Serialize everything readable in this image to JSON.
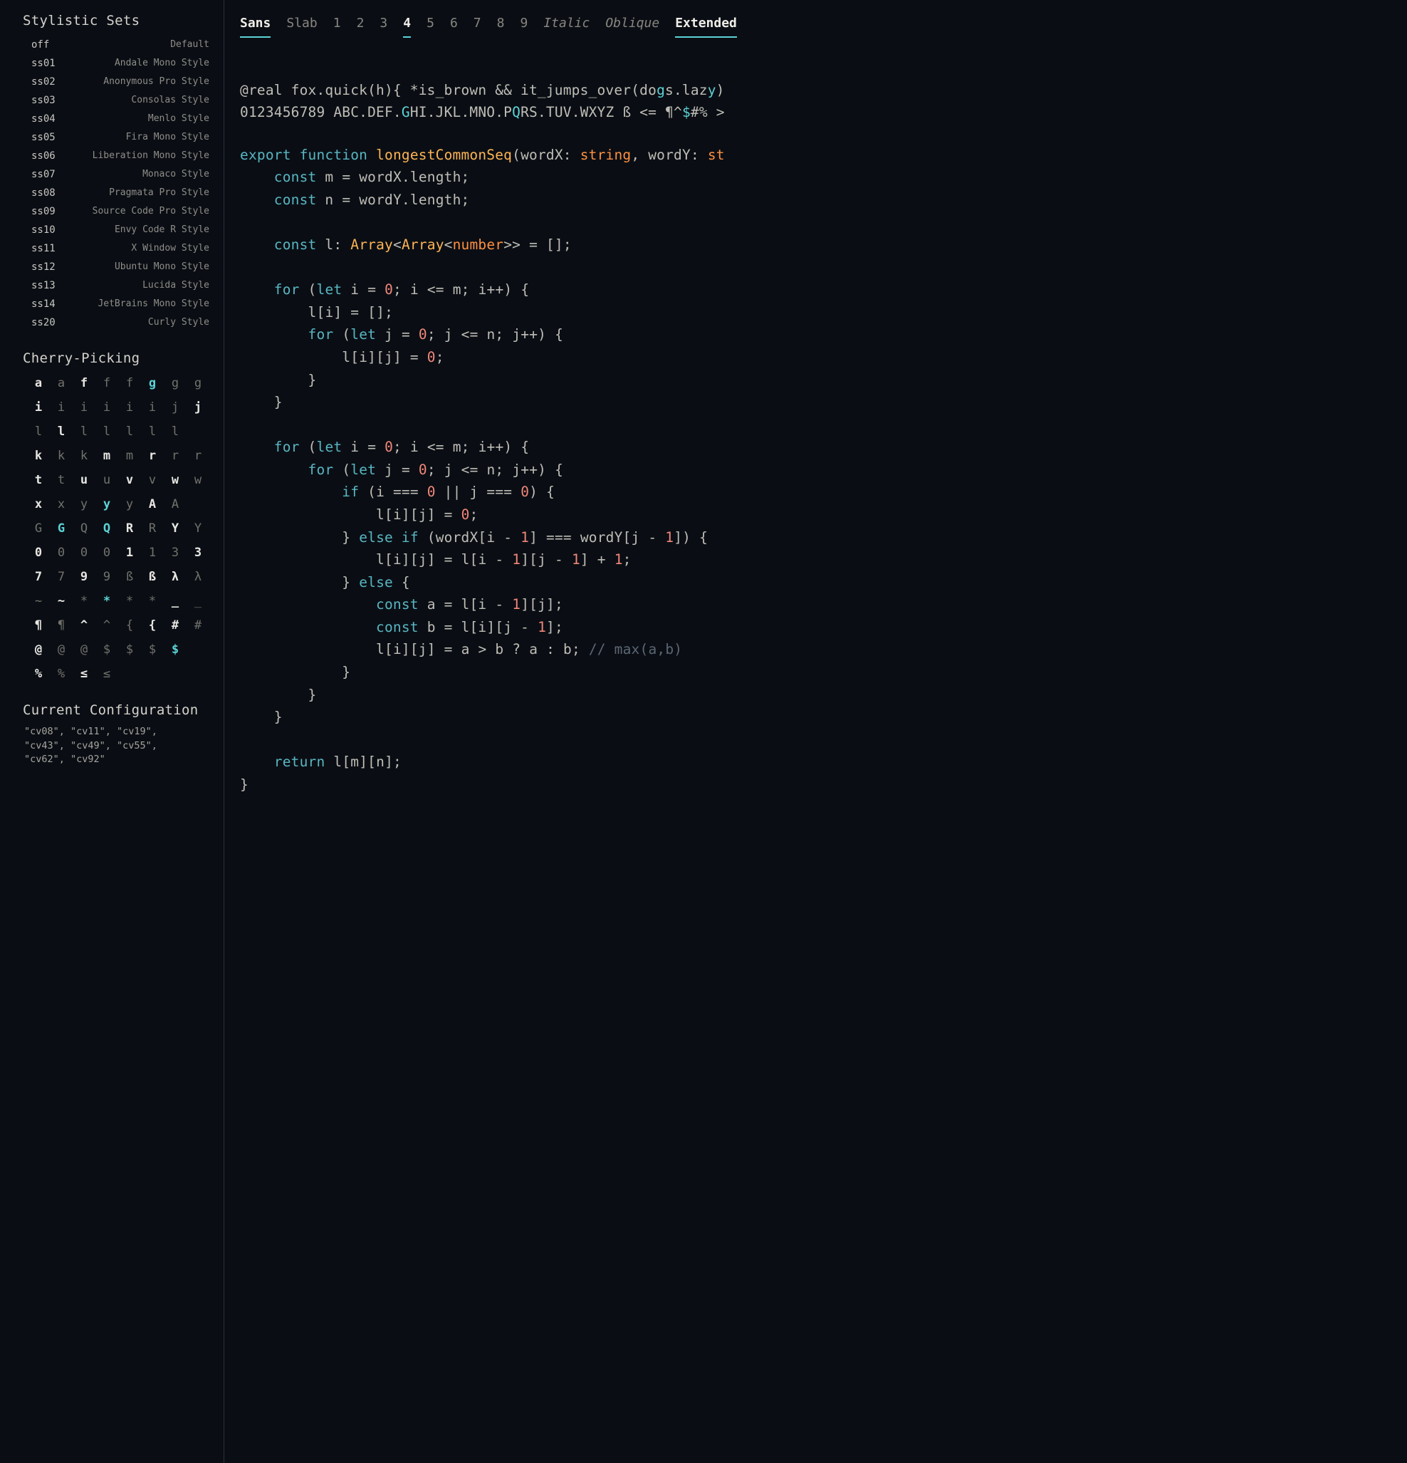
{
  "sidebar": {
    "stylistic_heading": "Stylistic Sets",
    "sets": [
      {
        "code": "off",
        "desc": "Default"
      },
      {
        "code": "ss01",
        "desc": "Andale Mono Style"
      },
      {
        "code": "ss02",
        "desc": "Anonymous Pro Style"
      },
      {
        "code": "ss03",
        "desc": "Consolas Style"
      },
      {
        "code": "ss04",
        "desc": "Menlo Style"
      },
      {
        "code": "ss05",
        "desc": "Fira Mono Style"
      },
      {
        "code": "ss06",
        "desc": "Liberation Mono Style"
      },
      {
        "code": "ss07",
        "desc": "Monaco Style"
      },
      {
        "code": "ss08",
        "desc": "Pragmata Pro Style"
      },
      {
        "code": "ss09",
        "desc": "Source Code Pro Style"
      },
      {
        "code": "ss10",
        "desc": "Envy Code R Style"
      },
      {
        "code": "ss11",
        "desc": "X Window Style"
      },
      {
        "code": "ss12",
        "desc": "Ubuntu Mono Style"
      },
      {
        "code": "ss13",
        "desc": "Lucida Style"
      },
      {
        "code": "ss14",
        "desc": "JetBrains Mono Style"
      },
      {
        "code": "ss20",
        "desc": "Curly Style"
      }
    ],
    "cherry_heading": "Cherry-Picking",
    "cherry": [
      {
        "g": "a",
        "s": 1
      },
      {
        "g": "a",
        "s": 0
      },
      {
        "g": "f",
        "s": 1
      },
      {
        "g": "f",
        "s": 0
      },
      {
        "g": "f",
        "s": 0
      },
      {
        "g": "g",
        "s": 2
      },
      {
        "g": "g",
        "s": 0
      },
      {
        "g": "g",
        "s": 0
      },
      {
        "g": "i",
        "s": 1
      },
      {
        "g": "i",
        "s": 0
      },
      {
        "g": "i",
        "s": 0
      },
      {
        "g": "i",
        "s": 0
      },
      {
        "g": "i",
        "s": 0
      },
      {
        "g": "i",
        "s": 0
      },
      {
        "g": "j",
        "s": 0
      },
      {
        "g": "j",
        "s": 1
      },
      {
        "g": "l",
        "s": 0
      },
      {
        "g": "l",
        "s": 1
      },
      {
        "g": "l",
        "s": 0
      },
      {
        "g": "l",
        "s": 0
      },
      {
        "g": "l",
        "s": 0
      },
      {
        "g": "l",
        "s": 0
      },
      {
        "g": "l",
        "s": 0
      },
      {
        "g": "",
        "s": 0
      },
      {
        "g": "k",
        "s": 1
      },
      {
        "g": "k",
        "s": 0
      },
      {
        "g": "k",
        "s": 0
      },
      {
        "g": "m",
        "s": 1
      },
      {
        "g": "m",
        "s": 0
      },
      {
        "g": "r",
        "s": 1
      },
      {
        "g": "r",
        "s": 0
      },
      {
        "g": "r",
        "s": 0
      },
      {
        "g": "t",
        "s": 1
      },
      {
        "g": "t",
        "s": 0
      },
      {
        "g": "u",
        "s": 1
      },
      {
        "g": "u",
        "s": 0
      },
      {
        "g": "v",
        "s": 1
      },
      {
        "g": "v",
        "s": 0
      },
      {
        "g": "w",
        "s": 1
      },
      {
        "g": "w",
        "s": 0
      },
      {
        "g": "x",
        "s": 1
      },
      {
        "g": "x",
        "s": 0
      },
      {
        "g": "y",
        "s": 0
      },
      {
        "g": "y",
        "s": 2
      },
      {
        "g": "y",
        "s": 0
      },
      {
        "g": "A",
        "s": 1
      },
      {
        "g": "A",
        "s": 0
      },
      {
        "g": "",
        "s": 0
      },
      {
        "g": "G",
        "s": 0
      },
      {
        "g": "G",
        "s": 2
      },
      {
        "g": "Q",
        "s": 0
      },
      {
        "g": "Q",
        "s": 2
      },
      {
        "g": "R",
        "s": 1
      },
      {
        "g": "R",
        "s": 0
      },
      {
        "g": "Y",
        "s": 1
      },
      {
        "g": "Y",
        "s": 0
      },
      {
        "g": "0",
        "s": 1
      },
      {
        "g": "0",
        "s": 0
      },
      {
        "g": "0",
        "s": 0
      },
      {
        "g": "0",
        "s": 0
      },
      {
        "g": "1",
        "s": 1
      },
      {
        "g": "1",
        "s": 0
      },
      {
        "g": "3",
        "s": 0
      },
      {
        "g": "3",
        "s": 1
      },
      {
        "g": "7",
        "s": 1
      },
      {
        "g": "7",
        "s": 0
      },
      {
        "g": "9",
        "s": 1
      },
      {
        "g": "9",
        "s": 0
      },
      {
        "g": "ß",
        "s": 0
      },
      {
        "g": "ß",
        "s": 1
      },
      {
        "g": "λ",
        "s": 1
      },
      {
        "g": "λ",
        "s": 0
      },
      {
        "g": "~",
        "s": 0
      },
      {
        "g": "~",
        "s": 1
      },
      {
        "g": "*",
        "s": 0
      },
      {
        "g": "*",
        "s": 2
      },
      {
        "g": "*",
        "s": 0
      },
      {
        "g": "*",
        "s": 0
      },
      {
        "g": "_",
        "s": 1
      },
      {
        "g": "_",
        "s": 0
      },
      {
        "g": "¶",
        "s": 1
      },
      {
        "g": "¶",
        "s": 0
      },
      {
        "g": "^",
        "s": 1
      },
      {
        "g": "^",
        "s": 0
      },
      {
        "g": "{",
        "s": 0
      },
      {
        "g": "{",
        "s": 1
      },
      {
        "g": "#",
        "s": 1
      },
      {
        "g": "#",
        "s": 0
      },
      {
        "g": "@",
        "s": 1
      },
      {
        "g": "@",
        "s": 0
      },
      {
        "g": "@",
        "s": 0
      },
      {
        "g": "$",
        "s": 0
      },
      {
        "g": "$",
        "s": 0
      },
      {
        "g": "$",
        "s": 0
      },
      {
        "g": "$",
        "s": 2
      },
      {
        "g": "",
        "s": 0
      },
      {
        "g": "%",
        "s": 1
      },
      {
        "g": "%",
        "s": 0
      },
      {
        "g": "≤",
        "s": 1
      },
      {
        "g": "≤",
        "s": 0
      },
      {
        "g": "",
        "s": 0
      },
      {
        "g": "",
        "s": 0
      },
      {
        "g": "",
        "s": 0
      },
      {
        "g": "",
        "s": 0
      }
    ],
    "config_heading": "Current Configuration",
    "config_text": "\"cv08\", \"cv11\", \"cv19\", \"cv43\", \"cv49\", \"cv55\", \"cv62\", \"cv92\""
  },
  "tabs": [
    {
      "label": "Sans",
      "active": true
    },
    {
      "label": "Slab",
      "active": false
    },
    {
      "label": "1",
      "active": false
    },
    {
      "label": "2",
      "active": false
    },
    {
      "label": "3",
      "active": false
    },
    {
      "label": "4",
      "active": true
    },
    {
      "label": "5",
      "active": false
    },
    {
      "label": "6",
      "active": false
    },
    {
      "label": "7",
      "active": false
    },
    {
      "label": "8",
      "active": false
    },
    {
      "label": "9",
      "active": false
    },
    {
      "label": "Italic",
      "active": false,
      "italic": true
    },
    {
      "label": "Oblique",
      "active": false,
      "italic": true
    },
    {
      "label": "Extended",
      "active": true
    }
  ],
  "preview": {
    "pangram1_a": "@real fox.quick(h){ *is_brown && it_jumps_over(do",
    "pangram1_g": "g",
    "pangram1_b": "s.laz",
    "pangram1_y": "y",
    "pangram1_c": ")",
    "pangram2_a": "0123456789 ABC.DEF.",
    "pangram2_G": "G",
    "pangram2_b": "HI.JKL.MNO.P",
    "pangram2_Q": "Q",
    "pangram2_c": "RS.TUV.WXYZ ß <= ¶^",
    "pangram2_dollar": "$",
    "pangram2_d": "#% >",
    "kw_export": "export",
    "kw_function": "function",
    "fn_name": "longestCommonSeq",
    "p_wordX": "wordX",
    "kw_string": "string",
    "p_wordY": "wordY",
    "kw_st": "st",
    "kw_const": "const",
    "v_m": "m",
    "v_wordX": "wordX",
    "prop_length": "length",
    "v_n": "n",
    "v_wordY": "wordY",
    "v_l": "l",
    "type_Array": "Array",
    "type_number": "number",
    "kw_for": "for",
    "kw_let": "let",
    "v_i": "i",
    "num_0": "0",
    "v_j": "j",
    "kw_if": "if",
    "kw_else": "else",
    "num_1": "1",
    "v_a": "a",
    "v_b": "b",
    "cmt_max": "// max(a,b)",
    "kw_return": "return"
  }
}
